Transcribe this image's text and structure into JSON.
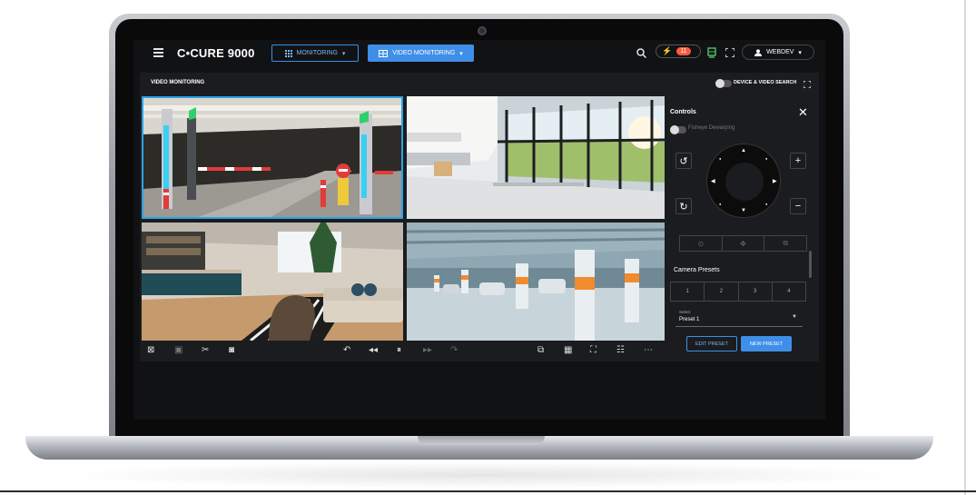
{
  "header": {
    "brand": "C•CURE 9000",
    "monitoring_label": "MONITORING",
    "video_monitoring_label": "VIDEO MONITORING",
    "alarm_count": "11",
    "user_label": "WEBDEV"
  },
  "main": {
    "title": "VIDEO MONITORING",
    "device_search_label": "DEVICE & VIDEO SEARCH"
  },
  "controls": {
    "title": "Controls",
    "fisheye_label": "Fisheye Dewarping",
    "camera_presets_title": "Camera Presets",
    "presets": [
      "1",
      "2",
      "3",
      "4"
    ],
    "select_label": "Select",
    "select_value": "Preset 1",
    "edit_preset": "EDIT PRESET",
    "new_preset": "NEW PRESET"
  },
  "icons": {
    "hamburger": "menu-icon",
    "search": "search-icon",
    "alarm": "lightning-icon",
    "status": "monitor-icon",
    "fullscreen": "fullscreen-icon",
    "user": "user-icon"
  },
  "colors": {
    "accent": "#3f8fe8",
    "alarm": "#ff5a3c",
    "selected_tile": "#2aa3e8"
  }
}
